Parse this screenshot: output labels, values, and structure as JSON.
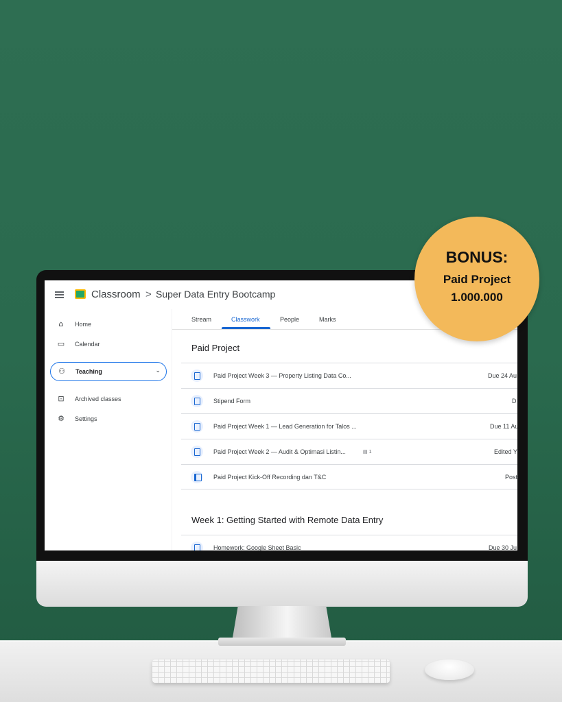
{
  "app": {
    "title": "Classroom",
    "breadcrumb_separator": ">",
    "course_title": "Super Data Entry Bootcamp"
  },
  "sidebar": {
    "items": [
      {
        "label": "Home",
        "icon": "home-icon"
      },
      {
        "label": "Calendar",
        "icon": "calendar-icon"
      },
      {
        "label": "Teaching",
        "icon": "people-icon",
        "expanded": false
      },
      {
        "label": "Archived classes",
        "icon": "archive-icon"
      },
      {
        "label": "Settings",
        "icon": "gear-icon"
      }
    ],
    "chevron": "⌄"
  },
  "tabs": [
    {
      "label": "Stream"
    },
    {
      "label": "Classwork",
      "active": true
    },
    {
      "label": "People"
    },
    {
      "label": "Marks"
    }
  ],
  "sections": [
    {
      "title": "Paid Project",
      "rows": [
        {
          "title": "Paid Project Week 3 — Property Listing Data Co...",
          "meta": "Due 24 Au",
          "icon": "assignment-icon"
        },
        {
          "title": "Stipend Form",
          "meta": "D",
          "icon": "assignment-icon"
        },
        {
          "title": "Paid Project Week 1 — Lead Generation for Talos ...",
          "meta": "Due 11 Au",
          "icon": "assignment-icon"
        },
        {
          "title": "Paid Project Week 2 — Audit & Optimasi Listin...",
          "comments": "1",
          "meta": "Edited Y",
          "icon": "assignment-icon"
        },
        {
          "title": "Paid Project Kick-Off Recording dan T&C",
          "meta": "Post",
          "icon": "material-icon"
        }
      ]
    },
    {
      "title": "Week 1: Getting Started with Remote Data Entry",
      "rows": [
        {
          "title": "Homework: Google Sheet Basic",
          "meta": "Due 30 Ju",
          "icon": "assignment-icon"
        }
      ]
    }
  ],
  "bonus": {
    "heading": "BONUS:",
    "line1": "Paid Project",
    "line2": "1.000.000"
  },
  "colors": {
    "wall": "#2e6e52",
    "accent": "#1967d2",
    "badge": "#f3b95a"
  }
}
